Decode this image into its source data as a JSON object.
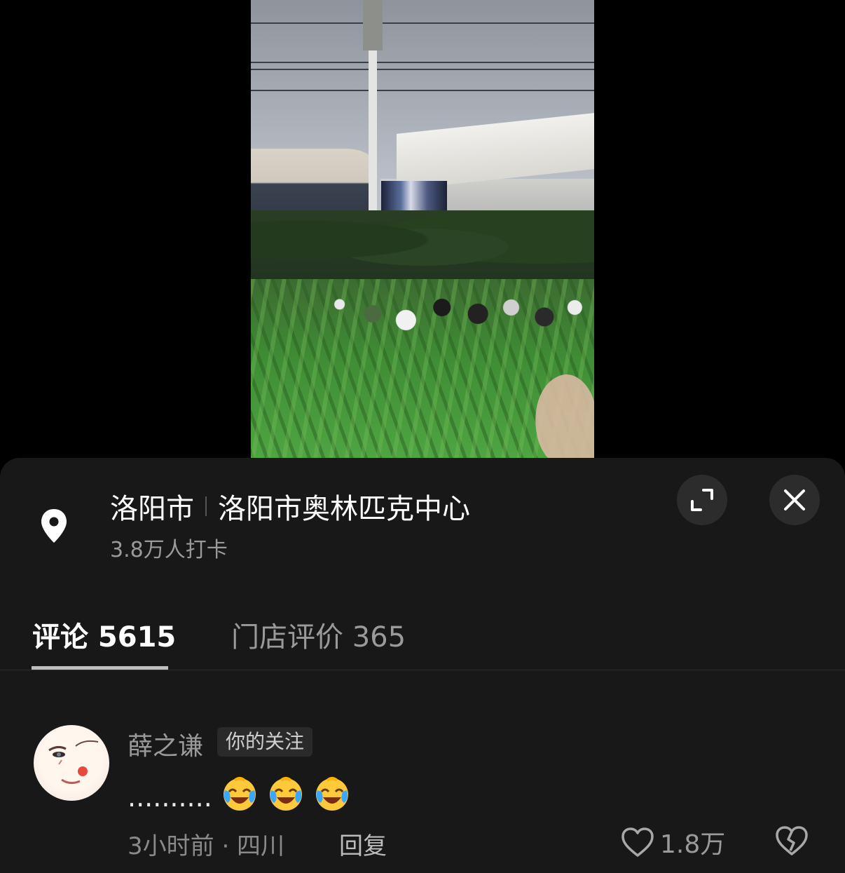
{
  "location": {
    "city": "洛阳市",
    "venue": "洛阳市奥林匹克中心",
    "checkins": "3.8万人打卡"
  },
  "icons": {
    "pin": "location-pin-icon",
    "expand": "expand-icon",
    "close": "close-icon",
    "heart": "heart-icon",
    "dislike": "broken-heart-icon"
  },
  "tabs": [
    {
      "label": "评论 5615",
      "active": true
    },
    {
      "label": "门店评价 365",
      "active": false
    }
  ],
  "comments": [
    {
      "username": "薛之谦",
      "badge": "你的关注",
      "text": "..........",
      "emojis": [
        "laughing-crying-emoji",
        "laughing-crying-emoji",
        "laughing-crying-emoji"
      ],
      "meta": "3小时前 · 四川",
      "reply_label": "回复",
      "likes": "1.8万"
    }
  ],
  "colors": {
    "sheet_bg": "#181818",
    "text_primary": "#ffffff",
    "text_secondary": "#9a9a9a",
    "emoji_yellow": "#ffc93c",
    "emoji_blue": "#3aa7ff"
  }
}
